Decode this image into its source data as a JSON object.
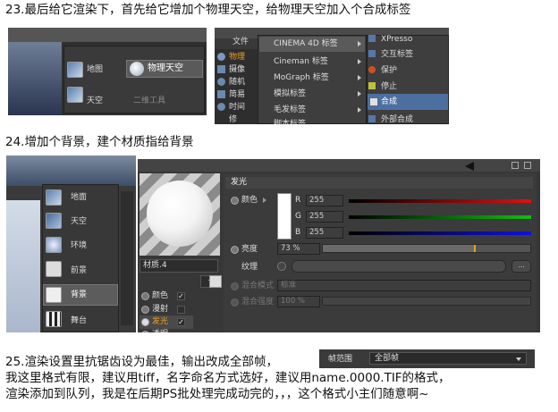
{
  "step23": {
    "text": "23.最后给它渲染下，首先给它增加个物理天空，给物理天空加入个合成标签",
    "left_shot": {
      "items": [
        "地图",
        "物理天空",
        "天空",
        "二维工具"
      ]
    },
    "right_shot": {
      "menu_file": "文件",
      "left_col": [
        "物理",
        "摄像",
        "随机",
        "简易",
        "时间",
        "修"
      ],
      "menu_items": [
        "CINEMA 4D 标签",
        "Cineman 标签",
        "MoGraph 标签",
        "模拟标签",
        "毛发标签",
        "脚本标签"
      ],
      "submenu": [
        "XPresso",
        "交互标签",
        "保护",
        "停止",
        "合成",
        "外部合成"
      ],
      "highlighted": "合成"
    }
  },
  "step24": {
    "text": "24.增加个背景，建个材质指给背景",
    "left_shot": {
      "items": [
        "地面",
        "天空",
        "环境",
        "前景",
        "背景",
        "舞台"
      ],
      "selected": "背景"
    },
    "material": {
      "name": "材质.4",
      "channels": [
        {
          "label": "颜色",
          "on": "✓"
        },
        {
          "label": "漫射",
          "on": ""
        },
        {
          "label": "发光",
          "on": "✓"
        },
        {
          "label": "透明",
          "on": ""
        }
      ],
      "panel_title": "发光",
      "color_label": "颜色",
      "r_label": "R",
      "r_value": "255",
      "g_label": "G",
      "g_value": "255",
      "b_label": "B",
      "b_value": "255",
      "brightness_label": "亮度",
      "brightness_value": "73 %",
      "brightness": 0.73,
      "texture_label": "纹理",
      "blend_mode_label": "混合模式",
      "blend_mode_value": "标准",
      "blend_strength_label": "混合强度",
      "blend_strength_value": "100 %"
    }
  },
  "step25": {
    "line1": "25.渲染设置里抗锯齿设为最佳，输出改成全部帧，",
    "line2": "我这里格式有限，建议用tiff，名字命名方式选好，建议用name.0000.TIF的格式，",
    "line3": "渲染添加到队列，我是在后期PS批处理完成动完的，，，这个格式小主们随意啊~",
    "range_label": "帧范围",
    "range_value": "全部帧"
  },
  "colors": {
    "ui_bg": "#333333",
    "highlight": "#4d6fa0",
    "red": "#e01010",
    "green": "#10c010",
    "blue": "#1010e0",
    "orange": "#e8a020"
  }
}
